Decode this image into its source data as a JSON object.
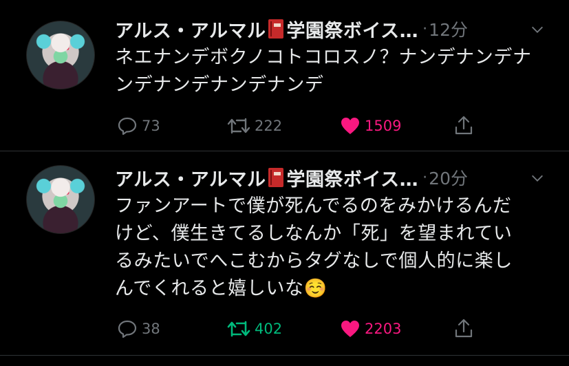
{
  "tweets": [
    {
      "name_a": "アルス・アルマル",
      "name_b": "学園祭ボイス…",
      "sep": "·",
      "time": "12分",
      "text": "ネエナンデボクノコトコロスノ？ナンデナンデナンデナンデナンデナンデ",
      "replies": "73",
      "retweets": "222",
      "likes": "1509",
      "retweet_active": false,
      "liked": true
    },
    {
      "name_a": "アルス・アルマル",
      "name_b": "学園祭ボイス…",
      "sep": "·",
      "time": "20分",
      "text": "ファンアートで僕が死んでるのをみかけるんだけど、僕生きてるしなんか「死」を望まれているみたいでへこむからタグなしで個人的に楽しんでくれると嬉しいな☺️",
      "replies": "38",
      "retweets": "402",
      "likes": "2203",
      "retweet_active": true,
      "liked": true
    }
  ],
  "icons": {
    "reply": "reply-icon",
    "retweet": "retweet-icon",
    "like": "heart-icon",
    "share": "share-icon",
    "more": "chevron-down-icon",
    "emoji": "book-emoji-icon"
  },
  "colors": {
    "background": "#000000",
    "text": "#e7e9ea",
    "muted": "#71767b",
    "like": "#f91880",
    "retweet_active": "#00ba7c",
    "divider": "#2f3336"
  }
}
